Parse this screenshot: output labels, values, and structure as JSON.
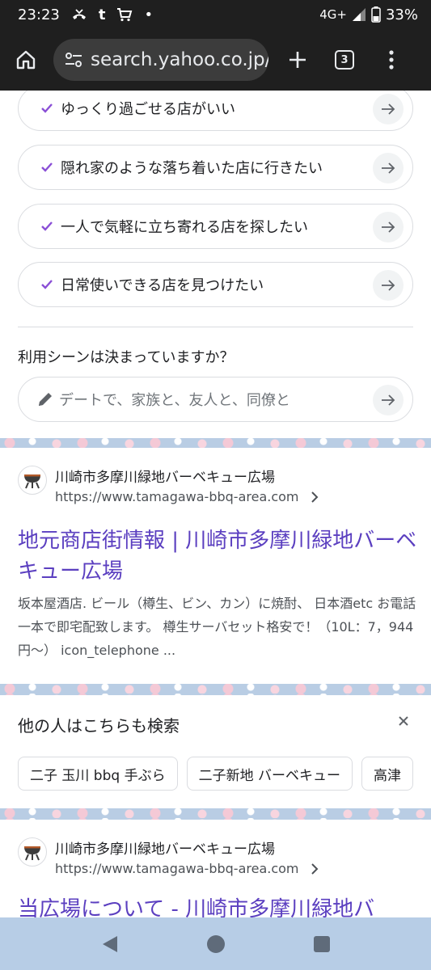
{
  "status": {
    "time": "23:23",
    "notif_t": "t",
    "dot": "•",
    "network": "4G+",
    "battery": "33%"
  },
  "browser": {
    "url": "search.yahoo.co.jp/",
    "tab_count": "3"
  },
  "suggestions": [
    {
      "label": "ゆっくり過ごせる店がいい"
    },
    {
      "label": "隠れ家のような落ち着いた店に行きたい"
    },
    {
      "label": "一人で気軽に立ち寄れる店を探したい"
    },
    {
      "label": "日常使いできる店を見つけたい"
    }
  ],
  "scene": {
    "question": "利用シーンは決まっていますか？",
    "placeholder": "デートで、家族と、友人と、同僚と"
  },
  "result1": {
    "site_name": "川崎市多摩川緑地バーベキュー広場",
    "url": "https://www.tamagawa-bbq-area.com",
    "title": "地元商店街情報 | 川崎市多摩川緑地バーベキュー広場",
    "snippet": "坂本屋酒店. ビール（樽生、ビン、カン）に焼酎、 日本酒etc お電話一本で即宅配致します。 樽生サーバセット格安で！（10L：7，944円〜） icon_telephone ..."
  },
  "others": {
    "title": "他の人はこちらも検索",
    "chips": [
      "二子 玉川 bbq 手ぶら",
      "二子新地 バーベキュー",
      "高津"
    ]
  },
  "result2": {
    "site_name": "川崎市多摩川緑地バーベキュー広場",
    "url": "https://www.tamagawa-bbq-area.com",
    "title": "当広場について - 川崎市多摩川緑地バ"
  },
  "colors": {
    "link_title": "#5b3fc0",
    "check_accent": "#8a4fd6",
    "navbar_bg": "#b7cde6"
  },
  "icons": [
    "home-icon",
    "site-settings-icon",
    "add-tab-icon",
    "menu-icon",
    "check-icon",
    "arrow-right-icon",
    "pencil-icon",
    "bbq-grill-icon",
    "chevron-right-icon",
    "close-icon",
    "back-icon",
    "home-nav-icon",
    "recents-icon"
  ]
}
